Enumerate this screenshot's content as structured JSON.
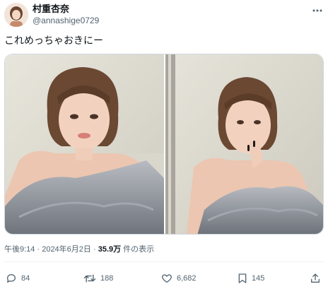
{
  "author": {
    "display_name": "村重杏奈",
    "handle": "@annashige0729"
  },
  "tweet": {
    "text": "これめっちゃおきにー"
  },
  "media": {
    "count": 2,
    "photos": [
      "photo-1",
      "photo-2"
    ]
  },
  "meta": {
    "time": "午後9:14",
    "separator": " · ",
    "date": "2024年6月2日",
    "views": "35.9万",
    "views_suffix": " 件の表示"
  },
  "actions": {
    "replies": "84",
    "retweets": "188",
    "likes": "6,682",
    "bookmarks": "145"
  },
  "icons": [
    "more-icon",
    "reply-icon",
    "retweet-icon",
    "like-icon",
    "bookmark-icon",
    "share-icon"
  ]
}
